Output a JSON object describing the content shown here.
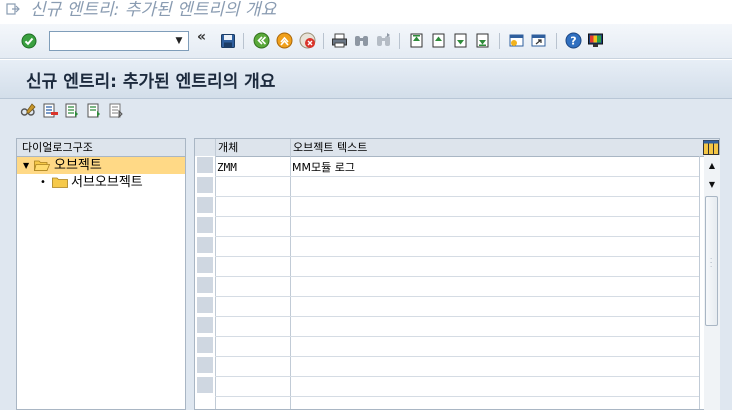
{
  "window": {
    "title": "신규 엔트리: 추가된 엔트리의 개요"
  },
  "toolbar": {
    "command_value": "",
    "command_placeholder": "",
    "nav_symbol": "«"
  },
  "screen": {
    "title": "신규 엔트리: 추가된 엔트리의 개요"
  },
  "tree": {
    "header": "다이얼로그구조",
    "nodes": [
      {
        "label": "오브젝트",
        "expanded": true,
        "selected": true
      },
      {
        "label": "서브오브젝트",
        "expanded": false,
        "selected": false
      }
    ]
  },
  "table": {
    "columns": [
      "개체",
      "오브젝트 텍스트"
    ],
    "rows": [
      {
        "object": "ZMM",
        "text": "MM모듈 로그"
      }
    ],
    "empty_rows": 11
  },
  "colors": {
    "selected_node": "#ffd986",
    "header_bg": "#d3deea",
    "accent": "#1c2a3d"
  },
  "icons": {
    "toolbar": [
      "enter-icon",
      "save-icon",
      "back-icon",
      "exit-icon",
      "cancel-icon",
      "print-icon",
      "find-icon",
      "find-next-icon",
      "first-page-icon",
      "previous-page-icon",
      "next-page-icon",
      "last-page-icon",
      "new-session-icon",
      "shortcut-icon",
      "help-icon",
      "customize-layout-icon"
    ],
    "app_toolbar": [
      "change-display-icon",
      "delete-icon",
      "select-all-icon",
      "select-block-icon",
      "deselect-all-icon"
    ]
  }
}
